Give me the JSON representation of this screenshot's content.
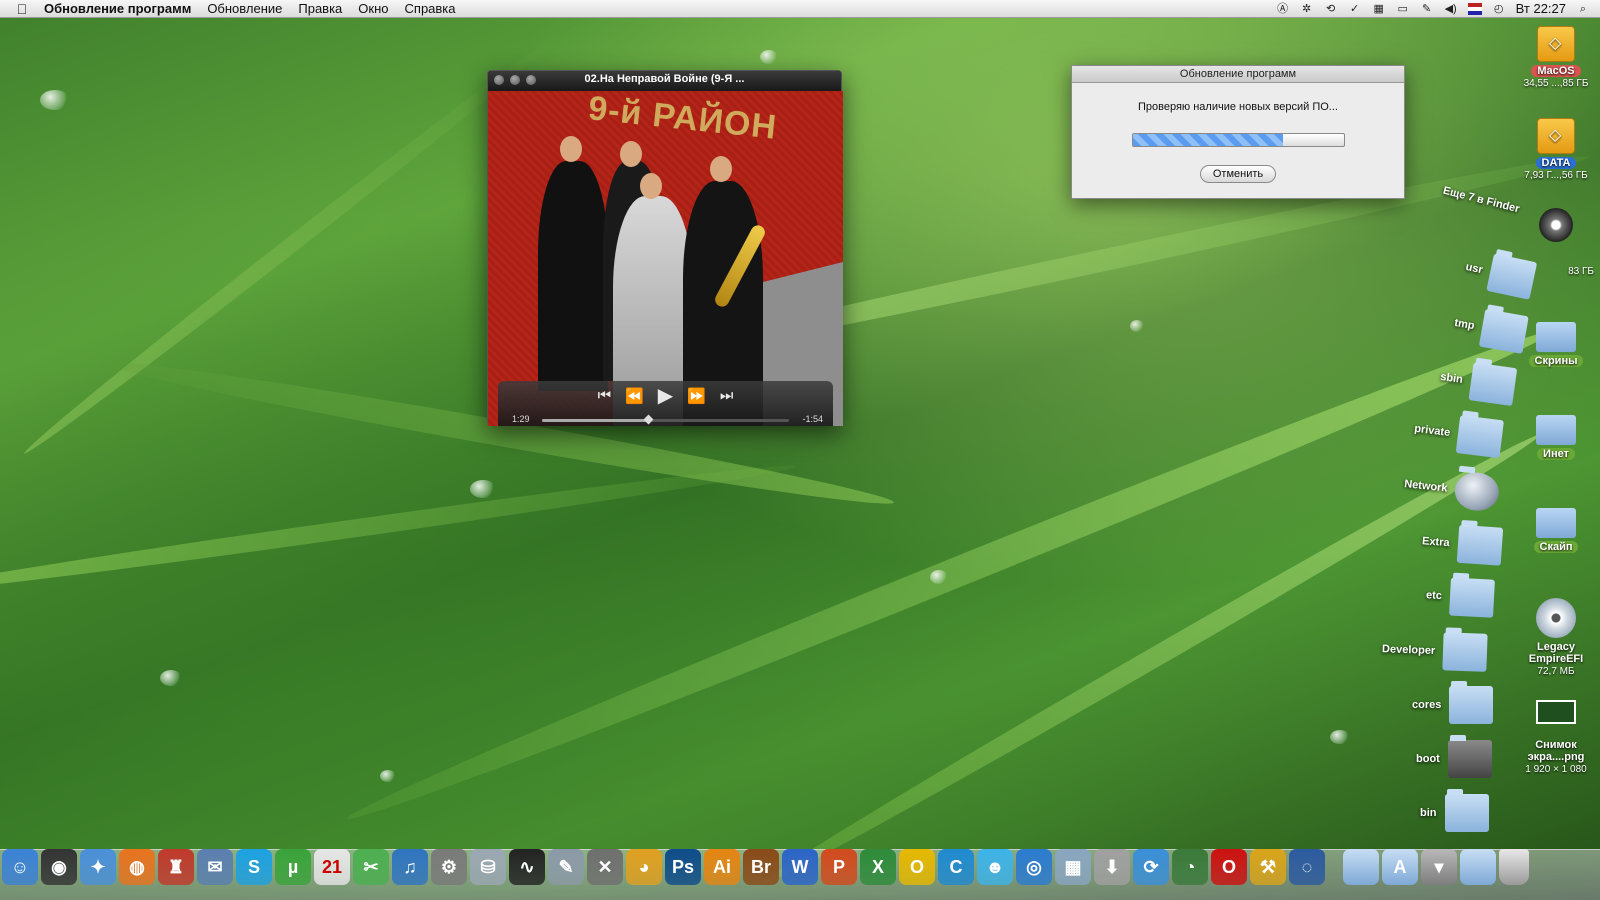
{
  "menubar": {
    "app_name": "Обновление программ",
    "items": [
      "Обновление",
      "Правка",
      "Окно",
      "Справка"
    ],
    "clock": "Вт 22:27"
  },
  "player": {
    "title": "02.На Неправой Войне (9-Я ...",
    "artwork_text": "9-й РАЙОН",
    "elapsed": "1:29",
    "remaining": "-1:54",
    "progress": 0.43
  },
  "update_dialog": {
    "title": "Обновление программ",
    "message": "Проверяю наличие новых версий ПО...",
    "progress": 0.71,
    "cancel_label": "Отменить"
  },
  "volumes": [
    {
      "label": "MacOS",
      "sub": "34,55 ...,85 ГБ"
    },
    {
      "label": "DATA",
      "sub": "7,93 Г...,56 ГБ"
    }
  ],
  "desktop_items": {
    "timemachine_sub": "83 ГБ",
    "screens_label": "Скрины",
    "inet_label": "Инет",
    "skype_label": "Скайп",
    "legacy_line1": "Legacy",
    "legacy_line2": "EmpireEFI",
    "legacy_sub": "72,7 МБ",
    "screenshot_line1": "Снимок",
    "screenshot_line2": "экра....png",
    "screenshot_sub": "1 920 × 1 080"
  },
  "fan": {
    "more_link": "Еще 7 в Finder",
    "folders": [
      "usr",
      "tmp",
      "sbin",
      "private",
      "Network",
      "Extra",
      "etc",
      "Developer",
      "cores",
      "boot",
      "bin"
    ]
  },
  "dock": {
    "icons": [
      {
        "name": "finder-icon",
        "glyph": "☺",
        "color": "#3b82d6"
      },
      {
        "name": "dashboard-icon",
        "glyph": "◉",
        "color": "#333333"
      },
      {
        "name": "safari-icon",
        "glyph": "✦",
        "color": "#4a90d9"
      },
      {
        "name": "firefox-icon",
        "glyph": "◍",
        "color": "#e8731e"
      },
      {
        "name": "puppet-icon",
        "glyph": "♜",
        "color": "#c0392b"
      },
      {
        "name": "mail-icon",
        "glyph": "✉",
        "color": "#5a7fb0"
      },
      {
        "name": "skype-icon",
        "glyph": "S",
        "color": "#1da1e2"
      },
      {
        "name": "utorrent-icon",
        "glyph": "µ",
        "color": "#3aa33a"
      },
      {
        "name": "calendar-icon",
        "glyph": "21",
        "color": "#e6e6e6"
      },
      {
        "name": "xslimmer-icon",
        "glyph": "✂",
        "color": "#4caf50"
      },
      {
        "name": "itunes-icon",
        "glyph": "♫",
        "color": "#2f74c0"
      },
      {
        "name": "system-preferences-icon",
        "glyph": "⚙",
        "color": "#7a7a7a"
      },
      {
        "name": "disk-utility-icon",
        "glyph": "⛁",
        "color": "#9ba7b3"
      },
      {
        "name": "activity-monitor-icon",
        "glyph": "∿",
        "color": "#222222"
      },
      {
        "name": "script-editor-icon",
        "glyph": "✎",
        "color": "#8c9aa8"
      },
      {
        "name": "utilities-icon",
        "glyph": "✕",
        "color": "#6f6f6f"
      },
      {
        "name": "chrome-icon",
        "glyph": "◕",
        "color": "#e0a020"
      },
      {
        "name": "photoshop-icon",
        "glyph": "Ps",
        "color": "#0e4c8a"
      },
      {
        "name": "illustrator-icon",
        "glyph": "Ai",
        "color": "#e48512"
      },
      {
        "name": "bridge-icon",
        "glyph": "Br",
        "color": "#8a4a18"
      },
      {
        "name": "word-icon",
        "glyph": "W",
        "color": "#2b64c8"
      },
      {
        "name": "powerpoint-icon",
        "glyph": "P",
        "color": "#d24a1e"
      },
      {
        "name": "excel-icon",
        "glyph": "X",
        "color": "#2e8b3a"
      },
      {
        "name": "outlook-icon",
        "glyph": "O",
        "color": "#e6b800"
      },
      {
        "name": "communicator-icon",
        "glyph": "C",
        "color": "#1f8ad0"
      },
      {
        "name": "messenger-icon",
        "glyph": "☻",
        "color": "#3db3e8"
      },
      {
        "name": "network-icon",
        "glyph": "◎",
        "color": "#2b7bd0"
      },
      {
        "name": "preview-icon",
        "glyph": "▦",
        "color": "#8aa6c0"
      },
      {
        "name": "installer-icon",
        "glyph": "⬇",
        "color": "#a0a0a0"
      },
      {
        "name": "migration-icon",
        "glyph": "⟳",
        "color": "#3a8fd8"
      },
      {
        "name": "clock-icon",
        "glyph": "◔",
        "color": "#3a7a3a"
      },
      {
        "name": "opera-icon",
        "glyph": "O",
        "color": "#cc1111"
      },
      {
        "name": "forklift-icon",
        "glyph": "⚒",
        "color": "#d9a41a"
      },
      {
        "name": "time-machine-icon",
        "glyph": "◌",
        "color": "#2c5aa0"
      }
    ],
    "right_icons": [
      {
        "name": "documents-folder-icon"
      },
      {
        "name": "applications-folder-icon"
      },
      {
        "name": "downloads-stack-icon"
      },
      {
        "name": "folder-stack-icon"
      },
      {
        "name": "trash-icon"
      }
    ]
  }
}
